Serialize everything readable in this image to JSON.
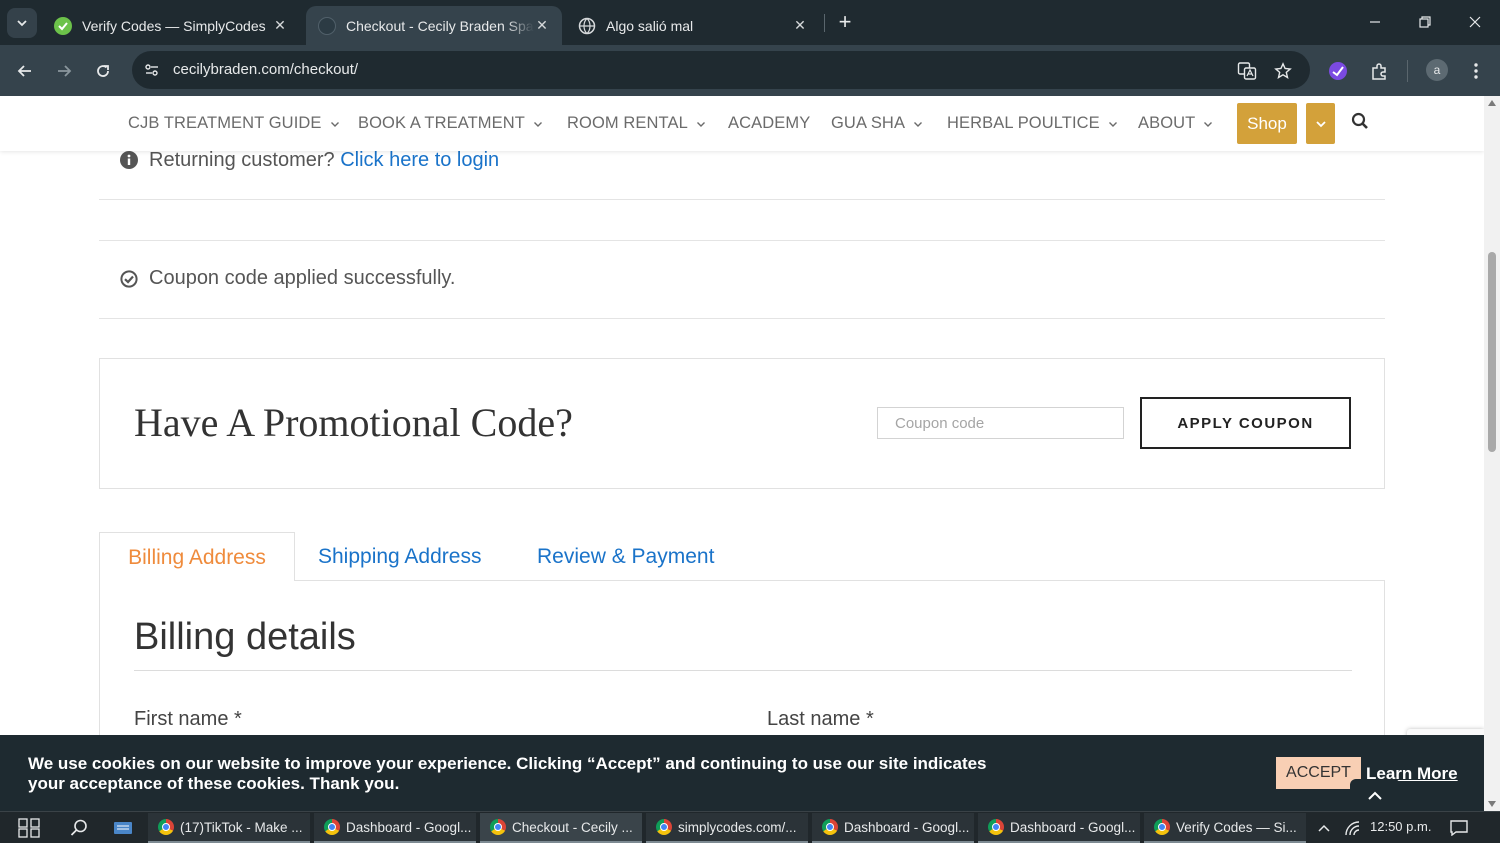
{
  "browser": {
    "tabs": [
      {
        "title": "Verify Codes — SimplyCodes",
        "active": false
      },
      {
        "title": "Checkout - Cecily Braden Spa & Academy",
        "active": true
      },
      {
        "title": "Algo salió mal",
        "active": false
      }
    ],
    "url": "cecilybraden.com/checkout/",
    "profile_initial": "a"
  },
  "site_nav": {
    "items": [
      {
        "label": "CJB TREATMENT GUIDE",
        "has_dropdown": true
      },
      {
        "label": "BOOK A TREATMENT",
        "has_dropdown": true
      },
      {
        "label": "ROOM RENTAL",
        "has_dropdown": true
      },
      {
        "label": "ACADEMY",
        "has_dropdown": false
      },
      {
        "label": "GUA SHA",
        "has_dropdown": true
      },
      {
        "label": "HERBAL POULTICE",
        "has_dropdown": true
      },
      {
        "label": "ABOUT",
        "has_dropdown": true
      }
    ],
    "shop_label": "Shop"
  },
  "notices": {
    "returning_text": "Returning customer?",
    "login_link": "Click here to login",
    "coupon_success": "Coupon code applied successfully."
  },
  "promo": {
    "title": "Have A Promotional Code?",
    "input_placeholder": "Coupon code",
    "input_value": "",
    "apply_label": "APPLY COUPON"
  },
  "checkout_tabs": [
    {
      "label": "Billing Address",
      "active": true
    },
    {
      "label": "Shipping Address",
      "active": false
    },
    {
      "label": "Review & Payment",
      "active": false
    }
  ],
  "billing": {
    "title": "Billing details",
    "first_name_label": "First name *",
    "last_name_label": "Last name *"
  },
  "cookie": {
    "text": "We use cookies on our website to improve your experience. Clicking “Accept” and continuing to use our site indicates your acceptance of these cookies. Thank you.",
    "accept_label": "ACCEPT",
    "learn_more_label": "Learn More"
  },
  "taskbar": {
    "items": [
      {
        "label": "(17)TikTok - Make ...",
        "active": false
      },
      {
        "label": "Dashboard - Googl...",
        "active": false
      },
      {
        "label": "Checkout - Cecily ...",
        "active": true
      },
      {
        "label": "simplycodes.com/...",
        "active": false
      },
      {
        "label": "Dashboard - Googl...",
        "active": false
      },
      {
        "label": "Dashboard - Googl...",
        "active": false
      },
      {
        "label": "Verify Codes — Si...",
        "active": false
      }
    ],
    "clock": "12:50 p.m."
  },
  "colors": {
    "accent_gold": "#d3a13a",
    "link_blue": "#1a73c9",
    "active_tab_orange": "#ef8b3c",
    "cookie_bg": "#1e2a30",
    "accept_bg": "#f8cfb4"
  }
}
